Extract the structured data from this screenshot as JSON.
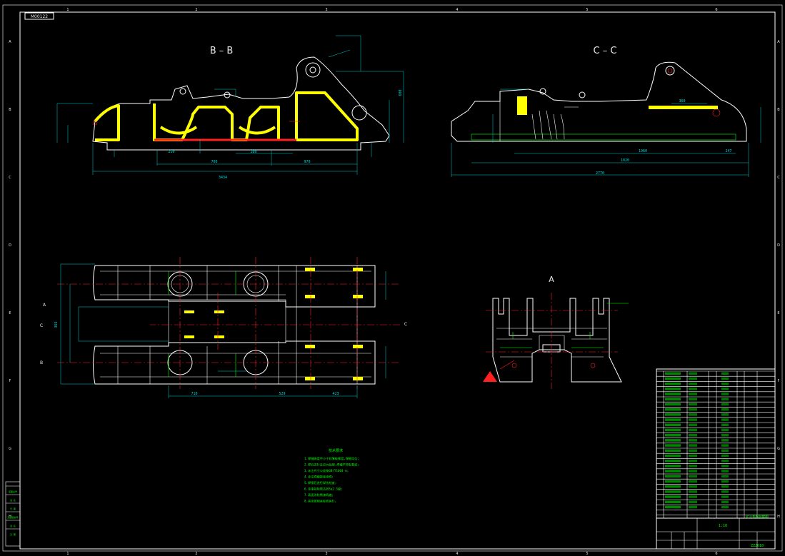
{
  "drawing": {
    "stamp": "M00122",
    "section_bb": "B – B",
    "section_cc": "C – C",
    "view_a": "A",
    "side_markers": {
      "a": "A",
      "b": "B",
      "c_left": "C",
      "c_right": "C"
    },
    "grid_top": [
      "1",
      "2",
      "3",
      "4",
      "5",
      "6"
    ],
    "grid_side": [
      "A",
      "B",
      "C",
      "D",
      "E",
      "F",
      "G",
      "H"
    ],
    "bb_dims": {
      "overall": "3434",
      "d1": "700",
      "d2": "970",
      "d3": "380",
      "d4": "250",
      "d5": "600"
    },
    "cc_dims": {
      "overall": "2770",
      "d1": "1020",
      "d2": "1960",
      "d3": "360",
      "d4": "247"
    },
    "plan_dims": {
      "d1": "710",
      "d2": "529",
      "d3": "423",
      "d4": "365"
    }
  },
  "notes": {
    "title": "技术要求",
    "lines": [
      "1.焊缝高度不小于较薄板厚度,焊缝均匀;",
      "2.焊后进行去应力处理,焊缝不得有裂纹;",
      "3.未注尺寸公差按GB/T1804-m;",
      "4.未注焊缝按连续焊;",
      "5.焊接后进行探伤检查;",
      "6.涂漆前除锈达到Sa2.5级;",
      "7.表面涂防锈漆两遍;",
      "8.其余按相关标准执行。"
    ]
  },
  "title_block": {
    "drawing_name": "铲斗机构装配图",
    "scale": "1:10",
    "drawing_no": "ZZ2010",
    "left_strip": [
      "底图总号",
      "签 名",
      "日 期",
      "旧底图总号",
      "签 名",
      "日 期"
    ]
  }
}
